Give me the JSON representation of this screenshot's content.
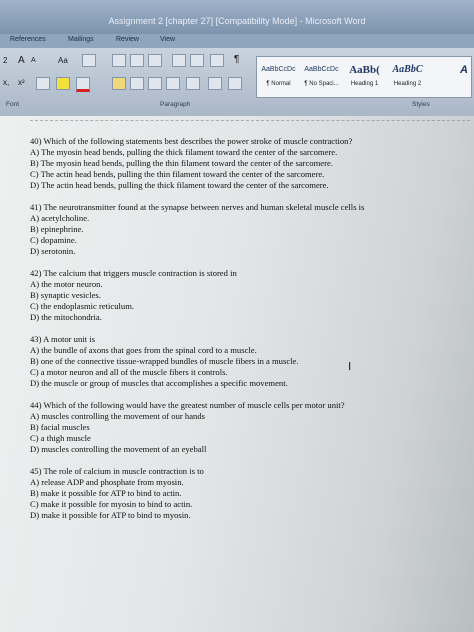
{
  "window": {
    "title": "Assignment 2 [chapter 27] [Compatibility Mode] - Microsoft Word"
  },
  "tabs": [
    "References",
    "Mailings",
    "Review",
    "View"
  ],
  "ribbon": {
    "font_group_label": "Font",
    "paragraph_group_label": "Paragraph",
    "styles_group_label": "Styles",
    "font_size_fragment": "2",
    "grow_font": "A",
    "shrink_font": "A",
    "change_case": "Aa",
    "subscript": "x,",
    "superscript": "x²",
    "pilcrow": "¶",
    "styles": [
      {
        "preview": "AaBbCcDc",
        "name": "¶ Normal"
      },
      {
        "preview": "AaBbCcDc",
        "name": "¶ No Spaci..."
      },
      {
        "preview": "AaBb(",
        "name": "Heading 1"
      },
      {
        "preview": "AaBbC",
        "name": "Heading 2"
      },
      {
        "preview": "A",
        "name": ""
      }
    ]
  },
  "document": {
    "questions": [
      {
        "stem": "40) Which of the following statements best describes the power stroke of muscle contraction?",
        "options": [
          {
            "letter": "A)",
            "text": "The myosin head bends, pulling the thick filament toward the center of the sarcomere."
          },
          {
            "letter": "B)",
            "text": "The myosin head bends, pulling the thin filament toward the center of the sarcomere."
          },
          {
            "letter": "C)",
            "text": "The actin head bends, pulling the thin filament toward the center of the sarcomere."
          },
          {
            "letter": "D)",
            "text": "The actin head bends, pulling the thick filament toward the center of the sarcomere."
          }
        ]
      },
      {
        "stem": "41) The neurotransmitter found at the synapse between nerves and human skeletal muscle cells is",
        "options": [
          {
            "letter": "A)",
            "text": "acetylcholine."
          },
          {
            "letter": "B)",
            "text": "epinephrine."
          },
          {
            "letter": "C)",
            "text": "dopamine."
          },
          {
            "letter": "D)",
            "text": "serotonin."
          }
        ]
      },
      {
        "stem": "42) The calcium that triggers muscle contraction is stored in",
        "options": [
          {
            "letter": "A)",
            "text": "the motor neuron."
          },
          {
            "letter": "B)",
            "text": "synaptic vesicles."
          },
          {
            "letter": "C)",
            "text": "the endoplasmic reticulum."
          },
          {
            "letter": "D)",
            "text": "the mitochondria."
          }
        ]
      },
      {
        "stem": "43) A motor unit is",
        "options": [
          {
            "letter": "A)",
            "text": "the bundle of axons that goes from the spinal cord to a muscle."
          },
          {
            "letter": "B)",
            "text": "one of the connective tissue-wrapped bundles of muscle fibers in a muscle."
          },
          {
            "letter": "C)",
            "text": "a motor neuron and all of the muscle fibers it controls."
          },
          {
            "letter": "D)",
            "text": "the muscle or group of muscles that accomplishes a specific movement."
          }
        ]
      },
      {
        "stem": "44) Which of the following would have the greatest number of muscle cells per motor unit?",
        "options": [
          {
            "letter": "A)",
            "text": "muscles controlling the movement of our hands"
          },
          {
            "letter": "B)",
            "text": "facial muscles"
          },
          {
            "letter": "C)",
            "text": "a thigh muscle"
          },
          {
            "letter": "D)",
            "text": "muscles controlling the movement of an eyeball"
          }
        ]
      },
      {
        "stem": "45) The role of calcium in muscle contraction is to",
        "options": [
          {
            "letter": "A)",
            "text": "release ADP and phosphate from myosin."
          },
          {
            "letter": "B)",
            "text": "make it possible for ATP to bind to actin."
          },
          {
            "letter": "C)",
            "text": "make it possible for myosin to bind to actin."
          },
          {
            "letter": "D)",
            "text": "make it possible for ATP to bind to myosin."
          }
        ]
      }
    ]
  }
}
